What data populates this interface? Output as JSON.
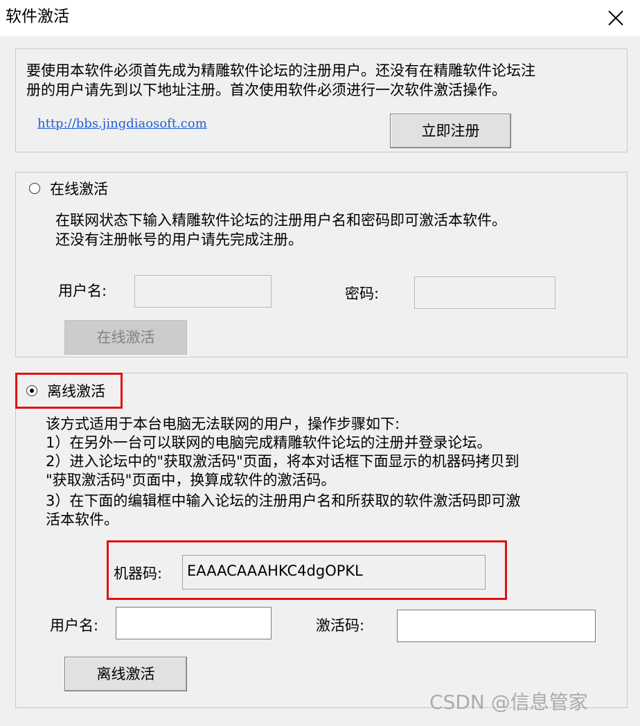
{
  "window": {
    "title": "软件激活",
    "close_icon": "close-icon"
  },
  "register_section": {
    "intro_line1": "要使用本软件必须首先成为精雕软件论坛的注册用户。还没有在精雕软件论坛注",
    "intro_line2": "册的用户请先到以下地址注册。首次使用软件必须进行一次软件激活操作。",
    "link_text": "http://bbs.jingdiaosoft.com",
    "register_button": "立即注册"
  },
  "online_section": {
    "radio_label": "在线激活",
    "selected": false,
    "desc_line1": "在联网状态下输入精雕软件论坛的注册用户名和密码即可激活本软件。",
    "desc_line2": "还没有注册帐号的用户请先完成注册。",
    "username_label": "用户名:",
    "username_value": "",
    "password_label": "密码:",
    "password_value": "",
    "activate_button": "在线激活"
  },
  "offline_section": {
    "radio_label": "离线激活",
    "selected": true,
    "desc_lines": [
      "该方式适用于本台电脑无法联网的用户，操作步骤如下:",
      "1）在另外一台可以联网的电脑完成精雕软件论坛的注册并登录论坛。",
      "2）进入论坛中的\"获取激活码\"页面，将本对话框下面显示的机器码拷贝到",
      "\"获取激活码\"页面中，换算成软件的激活码。",
      "3）在下面的编辑框中输入论坛的注册用户名和所获取的软件激活码即可激",
      "活本软件。"
    ],
    "machine_code_label": "机器码:",
    "machine_code_value": "EAAACAAAHKC4dgOPKL",
    "username_label": "用户名:",
    "username_value": "",
    "activation_code_label": "激活码:",
    "activation_code_value": "",
    "activate_button": "离线激活"
  },
  "colors": {
    "link": "#1f5fd6",
    "highlight_border": "#e01010",
    "dialog_background": "#f0f0f0"
  },
  "watermark": "CSDN @信息管家"
}
